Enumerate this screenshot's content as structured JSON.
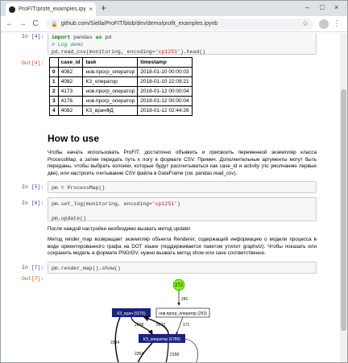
{
  "browser": {
    "tab_title": "ProFIT/profit_examples.ipynb at",
    "tab_close": "×",
    "new_tab": "+",
    "min": "–",
    "max": "□",
    "close": "×",
    "url": "github.com/Siella/ProFIT/blob/dev/demo/profit_examples.ipynb",
    "back": "←",
    "forward": "→",
    "reload": "C",
    "menu": "⋮"
  },
  "cells": {
    "c4_label": "In [4]:",
    "c4_line1_kw": "import",
    "c4_line1_mod": " pandas ",
    "c4_line1_as": "as",
    "c4_line1_alias": " pd",
    "c4_comment": "# Log demo",
    "c4_line3_a": "pd.read_csv(monitoring, encoding=",
    "c4_line3_str": "'cp1251'",
    "c4_line3_b": ").head()",
    "out4_label": "Out[4]:",
    "table": {
      "headers": [
        "",
        "case_id",
        "task",
        "timestamp"
      ],
      "rows": [
        [
          "0",
          "4082",
          "нов.прогр_оператор",
          "2018-01-10 00:00:03"
        ],
        [
          "1",
          "4082",
          "КЗ_оператор",
          "2018-01-10 22:09:21"
        ],
        [
          "2",
          "4173",
          "нов.прогр_оператор",
          "2018-01-12 00:00:04"
        ],
        [
          "3",
          "4176",
          "нов.прогр_оператор",
          "2018-01-12 00:00:04"
        ],
        [
          "4",
          "4082",
          "КЗ_врачФД",
          "2018-01-12 02:44:26"
        ]
      ]
    },
    "heading": "How to use",
    "para1": "Чтобы начать использовать ProFIT, достаточно объявить и присвоить переменной экземпляр класса ProcessMap, а затем передать путь к логу в формате CSV. Примеч. Дополнительные аргументы могут быть переданы, чтобы выбрать колонки, которые будут рассчитываться как case_id и activity (по умолчанию первые две), или настроить считывание CSV файла в DataFrame (см. pandas.read_csv).",
    "c5_label": "In [5]:",
    "c5_a": "pm ",
    "c5_eq": "=",
    "c5_b": " ProcessMap()",
    "c6_label": "In [6]:",
    "c6_line1_a": "pm.set_log(monitoring, encoding=",
    "c6_line1_str": "'cp1251'",
    "c6_line1_b": ")",
    "c6_line2": "pm.update()",
    "para2": "После каждой настройки необходимо вызвать метод update!",
    "para3": "Метод render_map возвращает экземпляр объекта Renderer, содержащий информацию о модели процесса в виде ориентированного графа на DOT языке (поддерживается пакетом утилит graphviz). Чтобы показать или сохранить модель в формате PNG/GV, нужно вызвать метод show или save соответственно.",
    "c7_label": "In [7]:",
    "c7_code": "pm.render_map().show()",
    "out7_label": "Out[7]:"
  },
  "graph": {
    "start_node": "272",
    "n1": "КЗ_врач (5275)",
    "n2": "нов.прогр_оператор (253)",
    "n3": "КЗ_оператор (6789)",
    "e_start": "241",
    "e1": "2268",
    "e2": "5672",
    "e3": "171",
    "e4": "2304",
    "e5": "2354",
    "e6": "2158"
  }
}
